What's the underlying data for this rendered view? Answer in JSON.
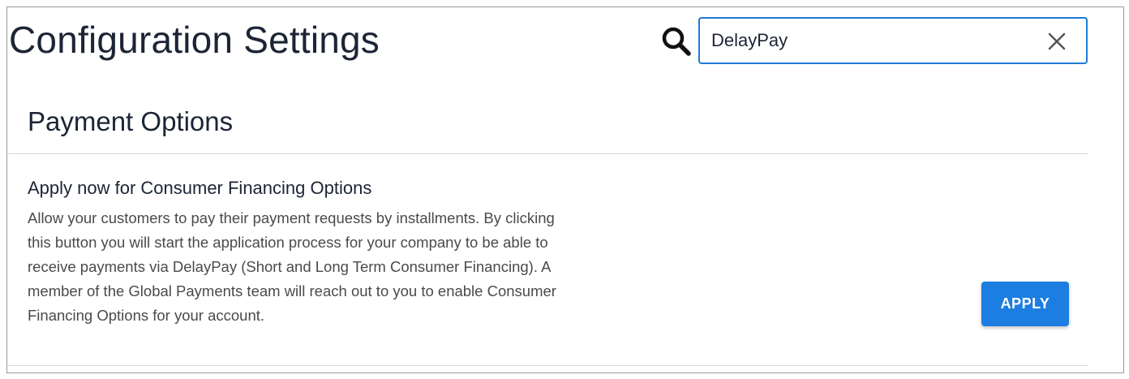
{
  "header": {
    "title": "Configuration Settings"
  },
  "search": {
    "value": "DelayPay",
    "icon": "search-icon",
    "clear_icon": "close-icon"
  },
  "section": {
    "title": "Payment Options",
    "setting": {
      "title": "Apply now for Consumer Financing Options",
      "description": "Allow your customers to pay their payment requests by installments. By clicking this button you will start the application process for your company to be able to receive payments via DelayPay (Short and Long Term Consumer Financing). A member of the Global Payments team will reach out to you to enable Consumer Financing Options for your account.",
      "button_label": "APPLY"
    }
  },
  "colors": {
    "accent": "#1b7ee0",
    "search_border": "#1f7ad6",
    "text": "#1c2535",
    "muted_text": "#4a4a4a",
    "divider": "#d8d8d8"
  }
}
